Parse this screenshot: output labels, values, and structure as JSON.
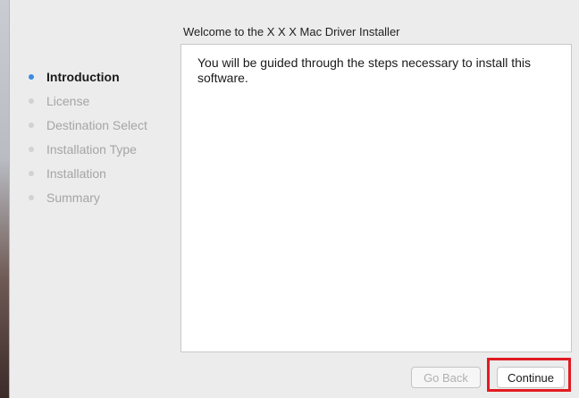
{
  "window": {
    "title": "Welcome to the X X X Mac Driver Installer"
  },
  "sidebar": {
    "steps": [
      {
        "label": "Introduction",
        "active": true
      },
      {
        "label": "License",
        "active": false
      },
      {
        "label": "Destination Select",
        "active": false
      },
      {
        "label": "Installation Type",
        "active": false
      },
      {
        "label": "Installation",
        "active": false
      },
      {
        "label": "Summary",
        "active": false
      }
    ]
  },
  "content": {
    "body": "You will be guided through the steps necessary to install this software."
  },
  "buttons": {
    "back_label": "Go Back",
    "back_enabled": false,
    "continue_label": "Continue",
    "continue_highlighted": true
  },
  "colors": {
    "active_step_dot": "#3a8be0",
    "inactive_step_dot": "#d2d2d2",
    "highlight_box": "#e11b22",
    "window_bg": "#ececec"
  }
}
